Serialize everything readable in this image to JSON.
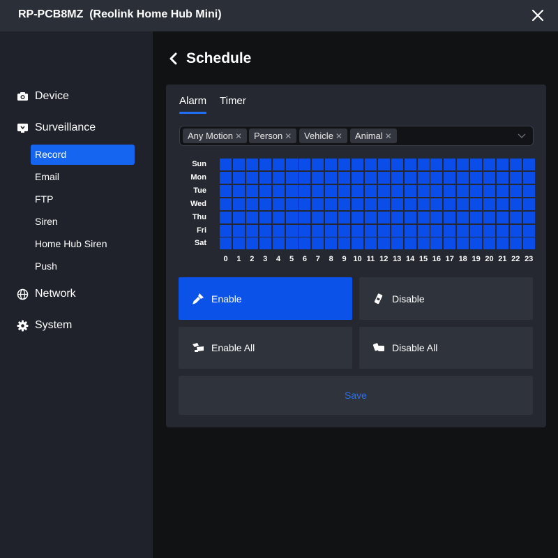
{
  "window": {
    "title": "RP-PCB8MZ  (Reolink Home Hub Mini)"
  },
  "sidebar": {
    "items": [
      {
        "label": "Device",
        "icon": "camera-icon"
      },
      {
        "label": "Surveillance",
        "icon": "monitor-icon",
        "children": [
          "Record",
          "Email",
          "FTP",
          "Siren",
          "Home Hub Siren",
          "Push"
        ],
        "active_child": "Record"
      },
      {
        "label": "Network",
        "icon": "globe-icon"
      },
      {
        "label": "System",
        "icon": "gear-icon"
      }
    ]
  },
  "page": {
    "title": "Schedule"
  },
  "tabs": [
    {
      "label": "Alarm",
      "active": true
    },
    {
      "label": "Timer",
      "active": false
    }
  ],
  "tags": [
    "Any Motion",
    "Person",
    "Vehicle",
    "Animal"
  ],
  "schedule": {
    "days": [
      "Sun",
      "Mon",
      "Tue",
      "Wed",
      "Thu",
      "Fri",
      "Sat"
    ],
    "hours": [
      "0",
      "1",
      "2",
      "3",
      "4",
      "5",
      "6",
      "7",
      "8",
      "9",
      "10",
      "11",
      "12",
      "13",
      "14",
      "15",
      "16",
      "17",
      "18",
      "19",
      "20",
      "21",
      "22",
      "23"
    ],
    "all_enabled": true
  },
  "actions": {
    "enable": "Enable",
    "disable": "Disable",
    "enable_all": "Enable All",
    "disable_all": "Disable All",
    "save": "Save"
  },
  "colors": {
    "accent": "#0a52e8",
    "cell_on": "#0a4de8",
    "save_text": "#2a6ff0"
  }
}
